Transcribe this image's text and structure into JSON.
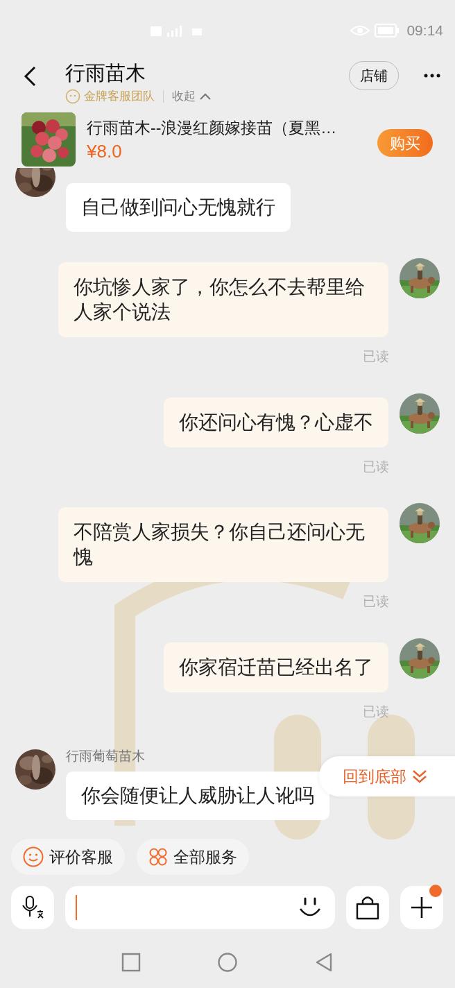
{
  "status_bar": {
    "time": "09:14"
  },
  "header": {
    "title": "行雨苗木",
    "badge": "金牌客服团队",
    "collapse": "收起",
    "shop_button": "店铺"
  },
  "product": {
    "title": "行雨苗木--浪漫红颜嫁接苗（夏黑…",
    "price": "¥8.0",
    "buy_button": "购买"
  },
  "messages": [
    {
      "kind": "incoming",
      "text": "自己做到问心无愧就行"
    },
    {
      "kind": "outgoing",
      "text": "你坑惨人家了，你怎么不去帮里给人家个说法",
      "status": "已读"
    },
    {
      "kind": "outgoing",
      "text": "你还问心有愧？心虚不",
      "status": "已读"
    },
    {
      "kind": "outgoing",
      "text": "不陪赏人家损失？你自己还问心无愧",
      "status": "已读"
    },
    {
      "kind": "outgoing",
      "text": "你家宿迁苗已经出名了",
      "status": "已读"
    },
    {
      "kind": "incoming",
      "sender": "行雨葡萄苗木",
      "text": "你会随便让人威胁让人讹吗"
    }
  ],
  "scroll_to_bottom": "回到底部",
  "quick_actions": [
    {
      "kind": "rate",
      "label": "评价客服"
    },
    {
      "kind": "services",
      "label": "全部服务"
    }
  ],
  "composer": {
    "plus_badge": true
  }
}
